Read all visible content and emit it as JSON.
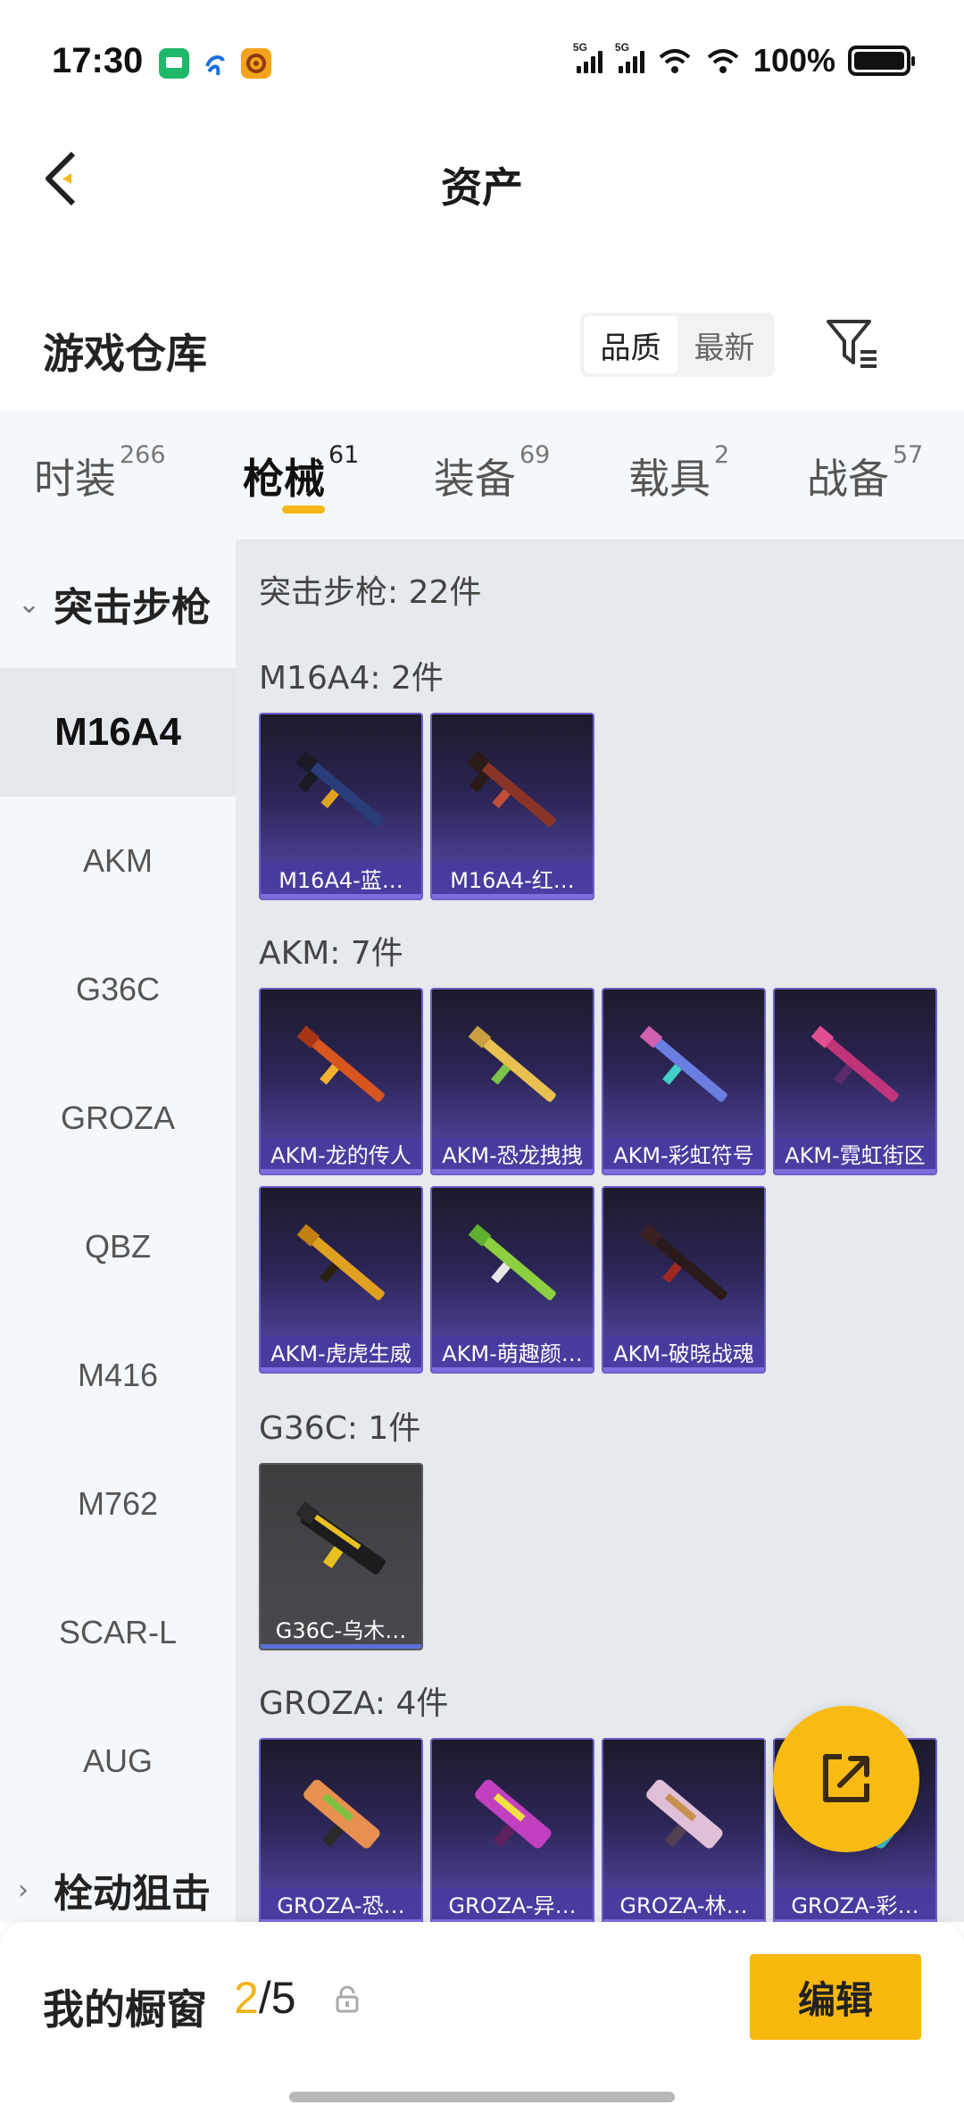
{
  "status_bar": {
    "time": "17:30",
    "battery": "100%",
    "network_a": "5G",
    "network_b": "5G"
  },
  "header": {
    "title": "资产"
  },
  "warehouse": {
    "title": "游戏仓库",
    "sort_options": [
      "品质",
      "最新"
    ],
    "active_sort": "品质"
  },
  "tabs": [
    {
      "label": "时装",
      "count": "266"
    },
    {
      "label": "枪械",
      "count": "61",
      "active": true
    },
    {
      "label": "装备",
      "count": "69"
    },
    {
      "label": "载具",
      "count": "2"
    },
    {
      "label": "战备",
      "count": "57"
    }
  ],
  "sidebar": {
    "group_expanded": "突击步枪",
    "items": [
      "M16A4",
      "AKM",
      "G36C",
      "GROZA",
      "QBZ",
      "M416",
      "M762",
      "SCAR-L",
      "AUG"
    ],
    "active_item": "M16A4",
    "group_collapsed": "栓动狙击"
  },
  "content": {
    "summary": "突击步枪: 22件",
    "groups": [
      {
        "title": "M16A4: 2件",
        "items": [
          "M16A4-蓝…",
          "M16A4-红…"
        ]
      },
      {
        "title": "AKM: 7件",
        "items": [
          "AKM-龙的传人",
          "AKM-恐龙拽拽",
          "AKM-彩虹符号",
          "AKM-霓虹街区",
          "AKM-虎虎生威",
          "AKM-萌趣颜…",
          "AKM-破晓战魂"
        ]
      },
      {
        "title": "G36C: 1件",
        "items": [
          "G36C-乌木…"
        ]
      },
      {
        "title": "GROZA: 4件",
        "items": [
          "GROZA-恐…",
          "GROZA-异…",
          "GROZA-林…",
          "GROZA-彩…"
        ]
      }
    ]
  },
  "bottom_bar": {
    "label": "我的橱窗",
    "count_current": "2",
    "count_total": "/5",
    "edit_label": "编辑"
  },
  "colors": {
    "accent": "#f8b80e",
    "card_purple": "#5a4db1",
    "card_grey": "#4c4c50"
  }
}
